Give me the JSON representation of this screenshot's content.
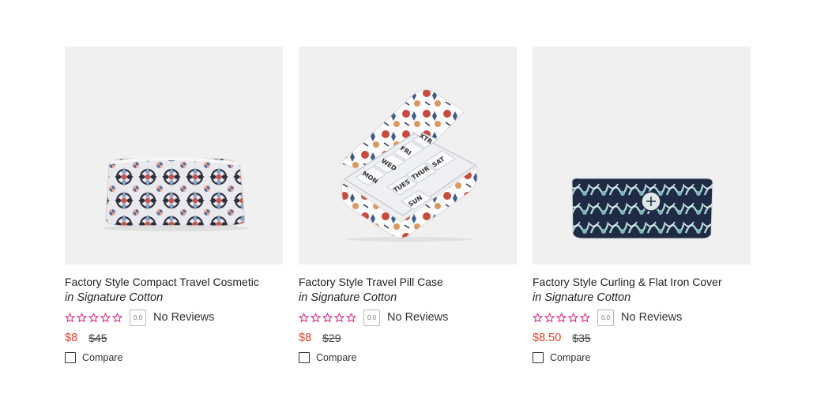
{
  "products": [
    {
      "title": "Factory Style Compact Travel Cosmetic",
      "material": "in Signature Cotton",
      "rating_score": "0.0",
      "stars_filled": 0,
      "reviews_label": "No Reviews",
      "sale_price": "$8",
      "original_price": "$45",
      "compare_label": "Compare"
    },
    {
      "title": "Factory Style Travel Pill Case",
      "material": "in Signature Cotton",
      "rating_score": "0.0",
      "stars_filled": 0,
      "reviews_label": "No Reviews",
      "sale_price": "$8",
      "original_price": "$29",
      "compare_label": "Compare",
      "pill_labels": [
        "MON",
        "WED",
        "FRI",
        "XTR",
        "TUES",
        "THUR",
        "SAT",
        "SUN"
      ]
    },
    {
      "title": "Factory Style Curling & Flat Iron Cover",
      "material": "in Signature Cotton",
      "rating_score": "0.0",
      "stars_filled": 0,
      "reviews_label": "No Reviews",
      "sale_price": "$8.50",
      "original_price": "$35",
      "compare_label": "Compare"
    }
  ],
  "colors": {
    "sale_price": "#e8412c",
    "star_outline": "#d6197f",
    "image_bg": "#f0f0f0"
  },
  "icons": {
    "rating_star": "star-outline-icon",
    "compare": "checkbox-icon"
  }
}
